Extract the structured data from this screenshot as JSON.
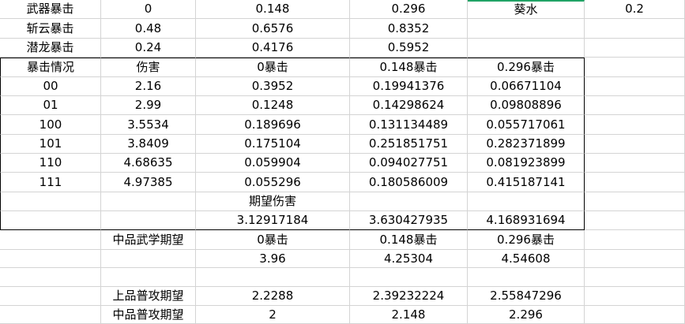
{
  "sheet": {
    "rows": [
      [
        "武器暴击",
        "0",
        "0.148",
        "0.296",
        "葵水",
        "0.2"
      ],
      [
        "斩云暴击",
        "0.48",
        "0.6576",
        "0.8352",
        "",
        ""
      ],
      [
        "潜龙暴击",
        "0.24",
        "0.4176",
        "0.5952",
        "",
        ""
      ],
      [
        "暴击情况",
        "伤害",
        "0暴击",
        "0.148暴击",
        "0.296暴击",
        ""
      ],
      [
        "00",
        "2.16",
        "0.3952",
        "0.19941376",
        "0.06671104",
        ""
      ],
      [
        "01",
        "2.99",
        "0.1248",
        "0.14298624",
        "0.09808896",
        ""
      ],
      [
        "100",
        "3.5534",
        "0.189696",
        "0.131134489",
        "0.055717061",
        ""
      ],
      [
        "101",
        "3.8409",
        "0.175104",
        "0.251851751",
        "0.282371899",
        ""
      ],
      [
        "110",
        "4.68635",
        "0.059904",
        "0.094027751",
        "0.081923899",
        ""
      ],
      [
        "111",
        "4.97385",
        "0.055296",
        "0.180586009",
        "0.415187141",
        ""
      ],
      [
        "",
        "",
        "期望伤害",
        "",
        "",
        ""
      ],
      [
        "",
        "",
        "3.12917184",
        "3.630427935",
        "4.168931694",
        ""
      ],
      [
        "",
        "中品武学期望",
        "0暴击",
        "0.148暴击",
        "0.296暴击",
        ""
      ],
      [
        "",
        "",
        "3.96",
        "4.25304",
        "4.54608",
        ""
      ],
      [
        "",
        "",
        "",
        "",
        "",
        ""
      ],
      [
        "",
        "上品普攻期望",
        "2.2288",
        "2.39232224",
        "2.55847296",
        ""
      ],
      [
        "",
        "中品普攻期望",
        "2",
        "2.148",
        "2.296",
        ""
      ]
    ]
  }
}
